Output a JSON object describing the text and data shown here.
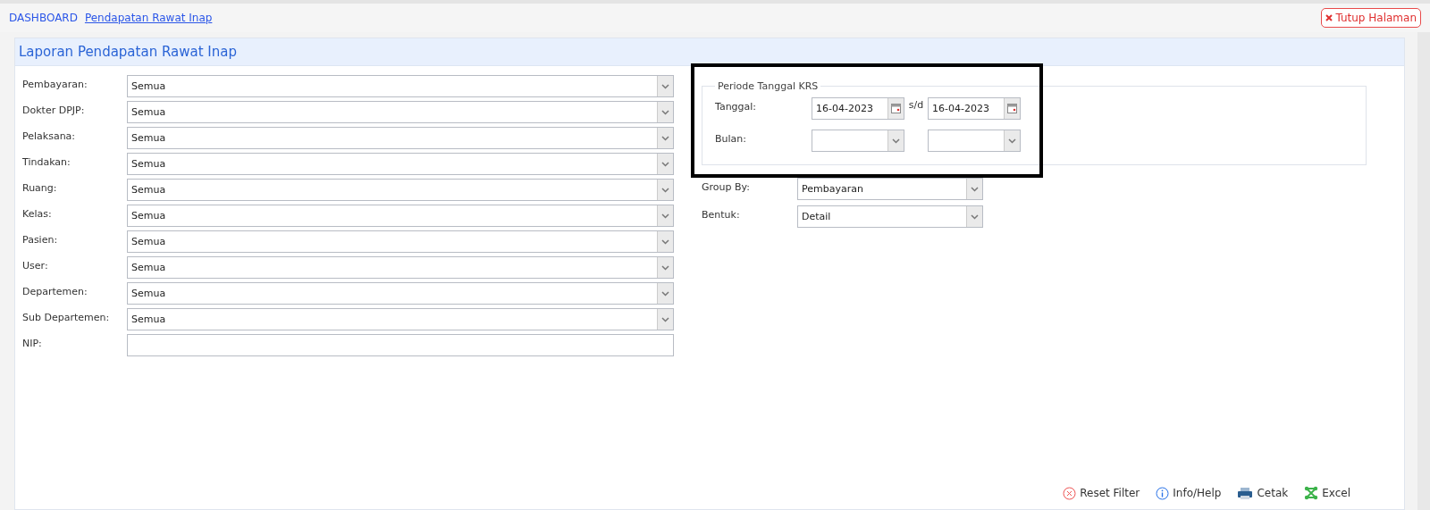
{
  "breadcrumb": [
    {
      "label": "DASHBOARD",
      "selected": false
    },
    {
      "label": "Pendapatan Rawat Inap",
      "selected": true
    }
  ],
  "close_button": "Tutup Halaman",
  "panel": {
    "title": "Laporan Pendapatan Rawat Inap"
  },
  "filters": [
    {
      "label": "Pembayaran:",
      "kind": "select",
      "value": "Semua"
    },
    {
      "label": "Dokter DPJP:",
      "kind": "select",
      "value": "Semua"
    },
    {
      "label": "Pelaksana:",
      "kind": "select",
      "value": "Semua"
    },
    {
      "label": "Tindakan:",
      "kind": "select",
      "value": "Semua"
    },
    {
      "label": "Ruang:",
      "kind": "select",
      "value": "Semua"
    },
    {
      "label": "Kelas:",
      "kind": "select",
      "value": "Semua"
    },
    {
      "label": "Pasien:",
      "kind": "select",
      "value": "Semua"
    },
    {
      "label": "User:",
      "kind": "select",
      "value": "Semua"
    },
    {
      "label": "Departemen:",
      "kind": "select",
      "value": "Semua"
    },
    {
      "label": "Sub Departemen:",
      "kind": "select",
      "value": "Semua"
    },
    {
      "label": "NIP:",
      "kind": "text"
    }
  ],
  "period": {
    "legend": "Periode Tanggal KRS",
    "date_label": "Tanggal:",
    "date_from": "16-04-2023",
    "separator": "s/d",
    "date_to": "16-04-2023",
    "month_label": "Bulan:"
  },
  "options": [
    {
      "label": "Group By:",
      "value": "Pembayaran"
    },
    {
      "label": "Bentuk:",
      "value": "Detail"
    }
  ],
  "actions": [
    {
      "kind": "reset",
      "label": "Reset Filter"
    },
    {
      "kind": "info",
      "label": "Info/Help"
    },
    {
      "kind": "print",
      "label": "Cetak"
    },
    {
      "kind": "excel",
      "label": "Excel"
    }
  ]
}
